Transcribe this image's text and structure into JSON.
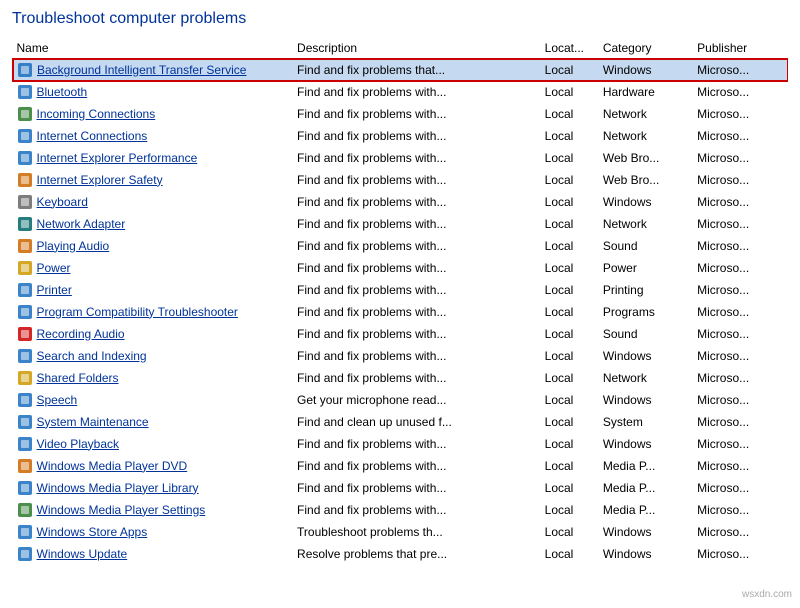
{
  "page": {
    "title": "Troubleshoot computer problems"
  },
  "columns": [
    {
      "id": "name",
      "label": "Name"
    },
    {
      "id": "description",
      "label": "Description"
    },
    {
      "id": "location",
      "label": "Locat..."
    },
    {
      "id": "category",
      "label": "Category"
    },
    {
      "id": "publisher",
      "label": "Publisher"
    }
  ],
  "items": [
    {
      "name": "Background Intelligent Transfer Service",
      "description": "Find and fix problems that...",
      "location": "Local",
      "category": "Windows",
      "publisher": "Microso...",
      "selected": true,
      "icon": "🔄",
      "iconClass": "icon-blue"
    },
    {
      "name": "Bluetooth",
      "description": "Find and fix problems with...",
      "location": "Local",
      "category": "Hardware",
      "publisher": "Microso...",
      "selected": false,
      "icon": "🔵",
      "iconClass": "icon-blue"
    },
    {
      "name": "Incoming Connections",
      "description": "Find and fix problems with...",
      "location": "Local",
      "category": "Network",
      "publisher": "Microso...",
      "selected": false,
      "icon": "🌐",
      "iconClass": "icon-green"
    },
    {
      "name": "Internet Connections",
      "description": "Find and fix problems with...",
      "location": "Local",
      "category": "Network",
      "publisher": "Microso...",
      "selected": false,
      "icon": "🌐",
      "iconClass": "icon-blue"
    },
    {
      "name": "Internet Explorer Performance",
      "description": "Find and fix problems with...",
      "location": "Local",
      "category": "Web Bro...",
      "publisher": "Microso...",
      "selected": false,
      "icon": "🌐",
      "iconClass": "icon-blue"
    },
    {
      "name": "Internet Explorer Safety",
      "description": "Find and fix problems with...",
      "location": "Local",
      "category": "Web Bro...",
      "publisher": "Microso...",
      "selected": false,
      "icon": "🌐",
      "iconClass": "icon-orange"
    },
    {
      "name": "Keyboard",
      "description": "Find and fix problems with...",
      "location": "Local",
      "category": "Windows",
      "publisher": "Microso...",
      "selected": false,
      "icon": "⌨",
      "iconClass": "icon-gray"
    },
    {
      "name": "Network Adapter",
      "description": "Find and fix problems with...",
      "location": "Local",
      "category": "Network",
      "publisher": "Microso...",
      "selected": false,
      "icon": "🌐",
      "iconClass": "icon-teal"
    },
    {
      "name": "Playing Audio",
      "description": "Find and fix problems with...",
      "location": "Local",
      "category": "Sound",
      "publisher": "Microso...",
      "selected": false,
      "icon": "🔊",
      "iconClass": "icon-orange"
    },
    {
      "name": "Power",
      "description": "Find and fix problems with...",
      "location": "Local",
      "category": "Power",
      "publisher": "Microso...",
      "selected": false,
      "icon": "⚡",
      "iconClass": "icon-yellow"
    },
    {
      "name": "Printer",
      "description": "Find and fix problems with...",
      "location": "Local",
      "category": "Printing",
      "publisher": "Microso...",
      "selected": false,
      "icon": "🖨",
      "iconClass": "icon-blue"
    },
    {
      "name": "Program Compatibility Troubleshooter",
      "description": "Find and fix problems with...",
      "location": "Local",
      "category": "Programs",
      "publisher": "Microso...",
      "selected": false,
      "icon": "💻",
      "iconClass": "icon-blue"
    },
    {
      "name": "Recording Audio",
      "description": "Find and fix problems with...",
      "location": "Local",
      "category": "Sound",
      "publisher": "Microso...",
      "selected": false,
      "icon": "🎙",
      "iconClass": "icon-red"
    },
    {
      "name": "Search and Indexing",
      "description": "Find and fix problems with...",
      "location": "Local",
      "category": "Windows",
      "publisher": "Microso...",
      "selected": false,
      "icon": "🔍",
      "iconClass": "icon-blue"
    },
    {
      "name": "Shared Folders",
      "description": "Find and fix problems with...",
      "location": "Local",
      "category": "Network",
      "publisher": "Microso...",
      "selected": false,
      "icon": "📁",
      "iconClass": "icon-yellow"
    },
    {
      "name": "Speech",
      "description": "Get your microphone read...",
      "location": "Local",
      "category": "Windows",
      "publisher": "Microso...",
      "selected": false,
      "icon": "🎤",
      "iconClass": "icon-blue"
    },
    {
      "name": "System Maintenance",
      "description": "Find and clean up unused f...",
      "location": "Local",
      "category": "System",
      "publisher": "Microso...",
      "selected": false,
      "icon": "⚙",
      "iconClass": "icon-blue"
    },
    {
      "name": "Video Playback",
      "description": "Find and fix problems with...",
      "location": "Local",
      "category": "Windows",
      "publisher": "Microso...",
      "selected": false,
      "icon": "🎬",
      "iconClass": "icon-blue"
    },
    {
      "name": "Windows Media Player DVD",
      "description": "Find and fix problems with...",
      "location": "Local",
      "category": "Media P...",
      "publisher": "Microso...",
      "selected": false,
      "icon": "💿",
      "iconClass": "icon-orange"
    },
    {
      "name": "Windows Media Player Library",
      "description": "Find and fix problems with...",
      "location": "Local",
      "category": "Media P...",
      "publisher": "Microso...",
      "selected": false,
      "icon": "🎵",
      "iconClass": "icon-blue"
    },
    {
      "name": "Windows Media Player Settings",
      "description": "Find and fix problems with...",
      "location": "Local",
      "category": "Media P...",
      "publisher": "Microso...",
      "selected": false,
      "icon": "🎵",
      "iconClass": "icon-green"
    },
    {
      "name": "Windows Store Apps",
      "description": "Troubleshoot problems th...",
      "location": "Local",
      "category": "Windows",
      "publisher": "Microso...",
      "selected": false,
      "icon": "🏪",
      "iconClass": "icon-blue"
    },
    {
      "name": "Windows Update",
      "description": "Resolve problems that pre...",
      "location": "Local",
      "category": "Windows",
      "publisher": "Microso...",
      "selected": false,
      "icon": "🔄",
      "iconClass": "icon-blue"
    }
  ],
  "watermark": "wsxdn.com"
}
